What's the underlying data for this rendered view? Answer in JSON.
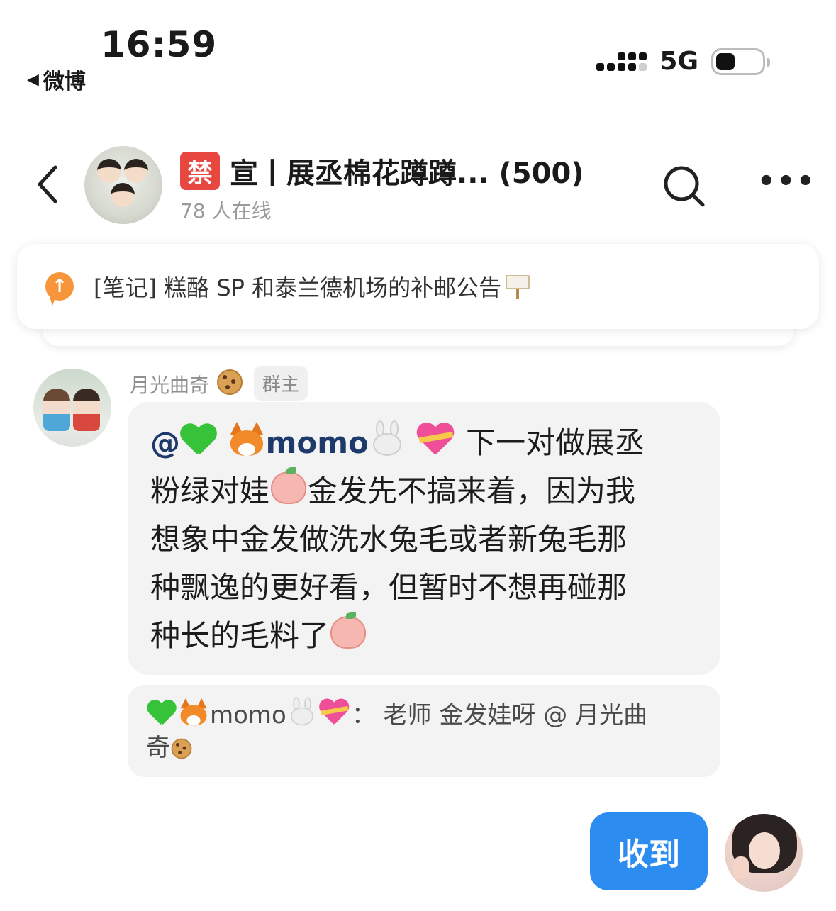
{
  "status_bar": {
    "time": "16:59",
    "back_app": "微博",
    "network": "5G"
  },
  "header": {
    "badge": "禁",
    "title": "宣丨展丞棉花蹲蹲... (500)",
    "subtitle": "78 人在线",
    "icons": [
      "back-chevron-icon",
      "search-icon",
      "more-icon"
    ]
  },
  "notice": {
    "text": "[笔记] 糕酪 SP 和泰兰德机场的补邮公告"
  },
  "message": {
    "sender": "月光曲奇",
    "role": "群主",
    "mention": "@",
    "mention_name": "momo",
    "line1_tail": " 下一对做展丞",
    "line2_head": "粉绿对娃",
    "line2_tail": "金发先不搞来着，因为我",
    "line3": "想象中金发做洗水兔毛或者新兔毛那",
    "line4": "种飘逸的更好看，但暂时不想再碰那",
    "line5": "种长的毛料了",
    "quote_name": "momo",
    "quote_text": "： 老师 金发娃呀 @ 月光曲",
    "quote_text2": "奇"
  },
  "reply": {
    "text": "收到"
  },
  "colors": {
    "accent": "#2d8cf0",
    "notice_icon": "#f7953a",
    "badge": "#e8473f",
    "bubble_bg": "#f3f3f3"
  }
}
